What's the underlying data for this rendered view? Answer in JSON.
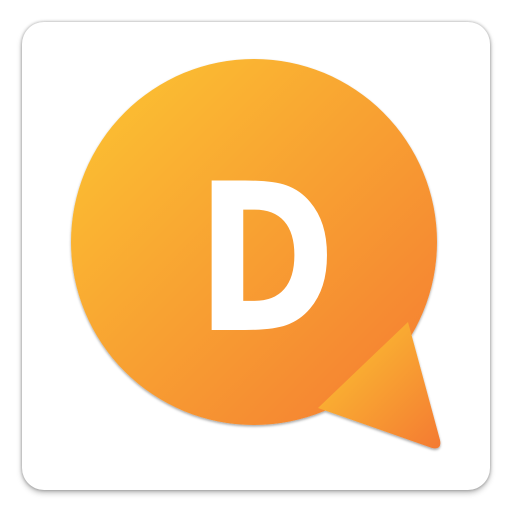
{
  "app_icon": {
    "letter": "D",
    "icon": "speech-bubble-icon",
    "colors": {
      "gradient_start": "#fcc631",
      "gradient_end": "#f47a31",
      "letter": "#ffffff",
      "tile": "#ffffff"
    }
  }
}
